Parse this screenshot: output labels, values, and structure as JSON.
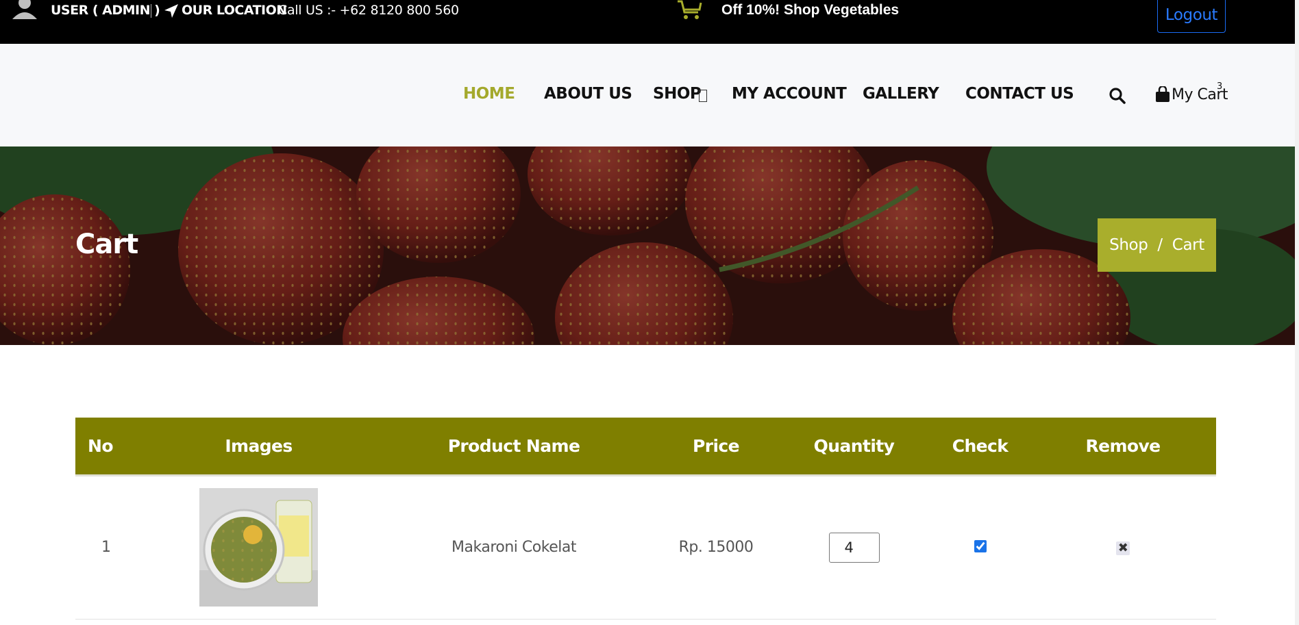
{
  "topbar": {
    "user_label": "USER ( ADMIN )",
    "location_label": "OUR LOCATION",
    "call_text": "Call US :- +62 8120 800 560",
    "promo": "Off 10%! Shop Vegetables",
    "logout": "Logout",
    "icons": [
      "user-icon",
      "location-arrow-icon",
      "shopping-cart-icon"
    ]
  },
  "nav": {
    "items": [
      {
        "label": "HOME",
        "active": true
      },
      {
        "label": "ABOUT US",
        "active": false
      },
      {
        "label": "SHOP",
        "active": false
      },
      {
        "label": "MY ACCOUNT",
        "active": false
      },
      {
        "label": "GALLERY",
        "active": false
      },
      {
        "label": "CONTACT US",
        "active": false
      }
    ],
    "cart_label": "My Cart",
    "cart_count": "3",
    "active_color": "#a4a92c"
  },
  "hero": {
    "title": "Cart",
    "breadcrumb": [
      "Shop",
      "/",
      "Cart"
    ],
    "breadcrumb_bg": "#a9ae2c"
  },
  "table": {
    "header_bg": "#7f7f00",
    "columns": [
      "No",
      "Images",
      "Product Name",
      "Price",
      "Quantity",
      "Check",
      "Remove"
    ],
    "rows": [
      {
        "no": "1",
        "product_name": "Makaroni Cokelat",
        "price": "Rp. 15000",
        "quantity": "4",
        "checked": true
      }
    ]
  }
}
